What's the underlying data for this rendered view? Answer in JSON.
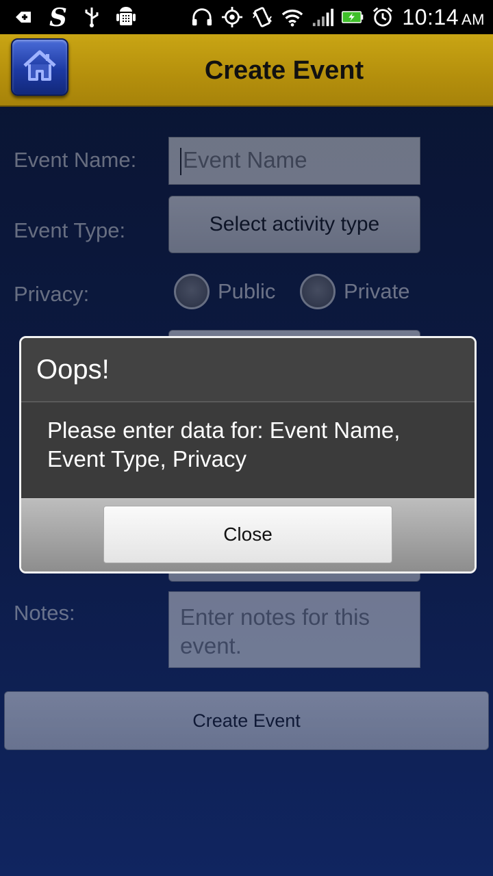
{
  "status_bar": {
    "time": "10:14",
    "ampm": "AM",
    "icons": [
      "add-notification-icon",
      "s-app-icon",
      "usb-icon",
      "android-debug-icon",
      "headphones-icon",
      "gps-icon",
      "vibrate-icon",
      "wifi-icon",
      "signal-icon",
      "battery-charging-icon",
      "alarm-icon"
    ]
  },
  "header": {
    "title": "Create Event",
    "home_icon": "home-icon"
  },
  "form": {
    "event_name_label": "Event Name:",
    "event_name_placeholder": "Event Name",
    "event_type_label": "Event Type:",
    "event_type_button": "Select activity type",
    "privacy_label": "Privacy:",
    "privacy_options": [
      "Public",
      "Private"
    ],
    "notes_label": "Notes:",
    "notes_placeholder": "Enter notes for this event.",
    "create_button": "Create Event"
  },
  "dialog": {
    "title": "Oops!",
    "message": "Please enter data for: Event Name, Event Type, Privacy",
    "close_button": "Close"
  }
}
